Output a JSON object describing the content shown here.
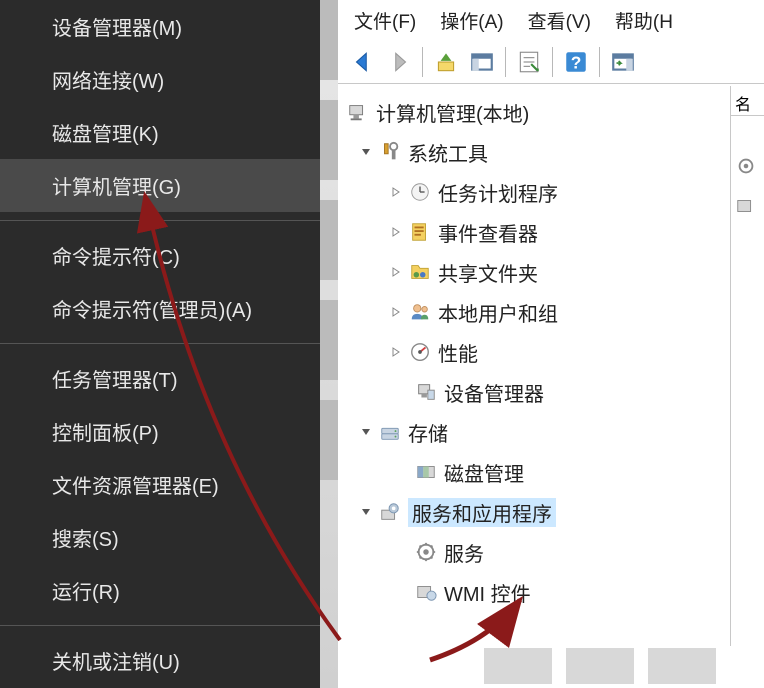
{
  "context_menu": {
    "items": [
      {
        "label": "设备管理器(M)",
        "divider_after": false
      },
      {
        "label": "网络连接(W)",
        "divider_after": false
      },
      {
        "label": "磁盘管理(K)",
        "divider_after": false
      },
      {
        "label": "计算机管理(G)",
        "highlighted": true,
        "divider_after": true
      },
      {
        "label": "命令提示符(C)",
        "divider_after": false
      },
      {
        "label": "命令提示符(管理员)(A)",
        "divider_after": true
      },
      {
        "label": "任务管理器(T)",
        "divider_after": false
      },
      {
        "label": "控制面板(P)",
        "divider_after": false
      },
      {
        "label": "文件资源管理器(E)",
        "divider_after": false
      },
      {
        "label": "搜索(S)",
        "divider_after": false
      },
      {
        "label": "运行(R)",
        "divider_after": true
      },
      {
        "label": "关机或注销(U)",
        "divider_after": false
      }
    ]
  },
  "mgmt": {
    "menubar": {
      "file": "文件(F)",
      "action": "操作(A)",
      "view": "查看(V)",
      "help": "帮助(H"
    },
    "column_header": "名",
    "tree": {
      "root": "计算机管理(本地)",
      "system_tools": "系统工具",
      "task_scheduler": "任务计划程序",
      "event_viewer": "事件查看器",
      "shared_folders": "共享文件夹",
      "local_users_groups": "本地用户和组",
      "performance": "性能",
      "device_manager": "设备管理器",
      "storage": "存储",
      "disk_mgmt": "磁盘管理",
      "services_apps": "服务和应用程序",
      "services": "服务",
      "wmi_control": "WMI 控件"
    }
  }
}
